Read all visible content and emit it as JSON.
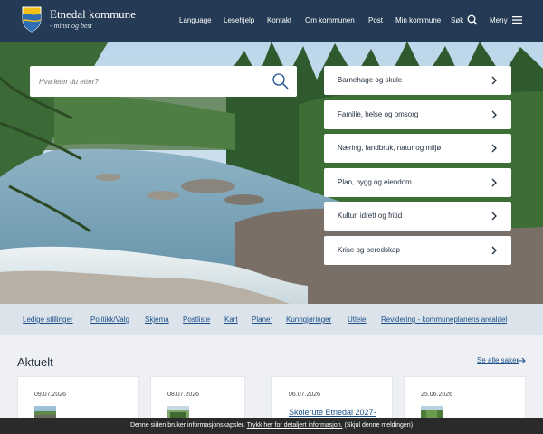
{
  "header": {
    "brand_name": "Etnedal kommune",
    "brand_tagline": "- minst og best",
    "nav": [
      "Language",
      "Lesehjelp",
      "Kontakt",
      "Om kommunen",
      "Post",
      "Min kommune"
    ],
    "search_label": "Søk",
    "menu_label": "Meny"
  },
  "search": {
    "placeholder": "Hva leter du etter?"
  },
  "categories": [
    "Barnehage og skule",
    "Familie, helse og omsorg",
    "Næring, landbruk, natur og miljø",
    "Plan, bygg og eiendom",
    "Kultur, idrett og fritid",
    "Krise og beredskap"
  ],
  "quick_links": [
    "Ledige stillinger",
    "Politikk/Valg",
    "Skjema",
    "Postliste",
    "Kart",
    "Planer",
    "Kunngjøringer",
    "Utleie",
    "Revidering - kommuneplanens arealdel"
  ],
  "news": {
    "title": "Aktuelt",
    "see_all": "Se alle saker",
    "cards": [
      {
        "date": "09.07.2026",
        "title": ""
      },
      {
        "date": "08.07.2026",
        "title": ""
      },
      {
        "date": "06.07.2026",
        "title": "Skolerute Etnedal 2027-"
      },
      {
        "date": "25.06.2026",
        "title": ""
      }
    ]
  },
  "cookie": {
    "text_before": "Denne siden bruker informasjonskapsler.",
    "link": "Trykk her for detaljert informasjon.",
    "dismiss": "(Skjul denne meldingen)"
  },
  "colors": {
    "header_bg": "#243a55",
    "link": "#1a4f8a",
    "quick_bar_bg": "#dde3ea",
    "cookie_bg": "#2a2a2a"
  }
}
